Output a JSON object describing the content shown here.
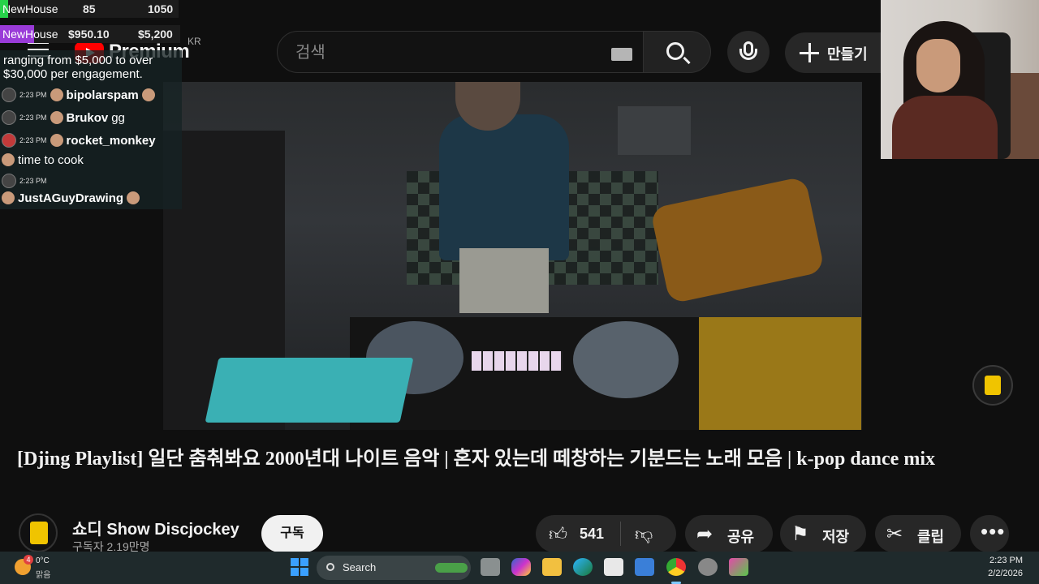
{
  "header": {
    "logo_text": "Premium",
    "country_code": "KR",
    "search_placeholder": "검색",
    "create_label": "만들기"
  },
  "video": {
    "title": "[Djing Playlist] 일단 춤춰봐요 2000년대 나이트 음악 | 혼자 있는데 떼창하는 기분드는 노래 모음  | k-pop dance mix",
    "channel_name": "쇼디 Show Discjockey",
    "subscribers": "구독자 2.19만명",
    "subscribe_label": "구독",
    "like_count": "541",
    "share_label": "공유",
    "save_label": "저장",
    "clip_label": "클립"
  },
  "stream_overlay": {
    "rows": [
      {
        "tag": "NewHouse",
        "value_a": "85",
        "value_b": "1050"
      },
      {
        "tag": "NewHouse",
        "value_a": "$950.10",
        "value_b": "$5,200"
      }
    ],
    "chat": {
      "partial_message": "ranging from $5,000 to over $30,000 per engagement.",
      "messages": [
        {
          "time": "2:23 PM",
          "user": "bipolarspam",
          "text": ""
        },
        {
          "time": "2:23 PM",
          "user": "Brukov",
          "text": "gg"
        },
        {
          "time": "2:23 PM",
          "user": "rocket_monkey",
          "text": "time to cook"
        },
        {
          "time": "2:23 PM",
          "user": "JustAGuyDrawing",
          "text": ""
        }
      ]
    }
  },
  "taskbar": {
    "weather_badge": "4",
    "temperature": "0°C",
    "condition": "맑음",
    "search_label": "Search",
    "time": "2:23 PM",
    "date": "2/2/2026",
    "app_icons": [
      "task-view-icon",
      "copilot-icon",
      "file-explorer-icon",
      "edge-icon",
      "store-icon",
      "app-icon",
      "chrome-icon",
      "app-icon",
      "app-icon"
    ]
  },
  "colors": {
    "youtube_red": "#ff0000",
    "accent_green": "#27d24a",
    "accent_purple": "#9a3bd8",
    "brand_yellow": "#f0c400"
  }
}
